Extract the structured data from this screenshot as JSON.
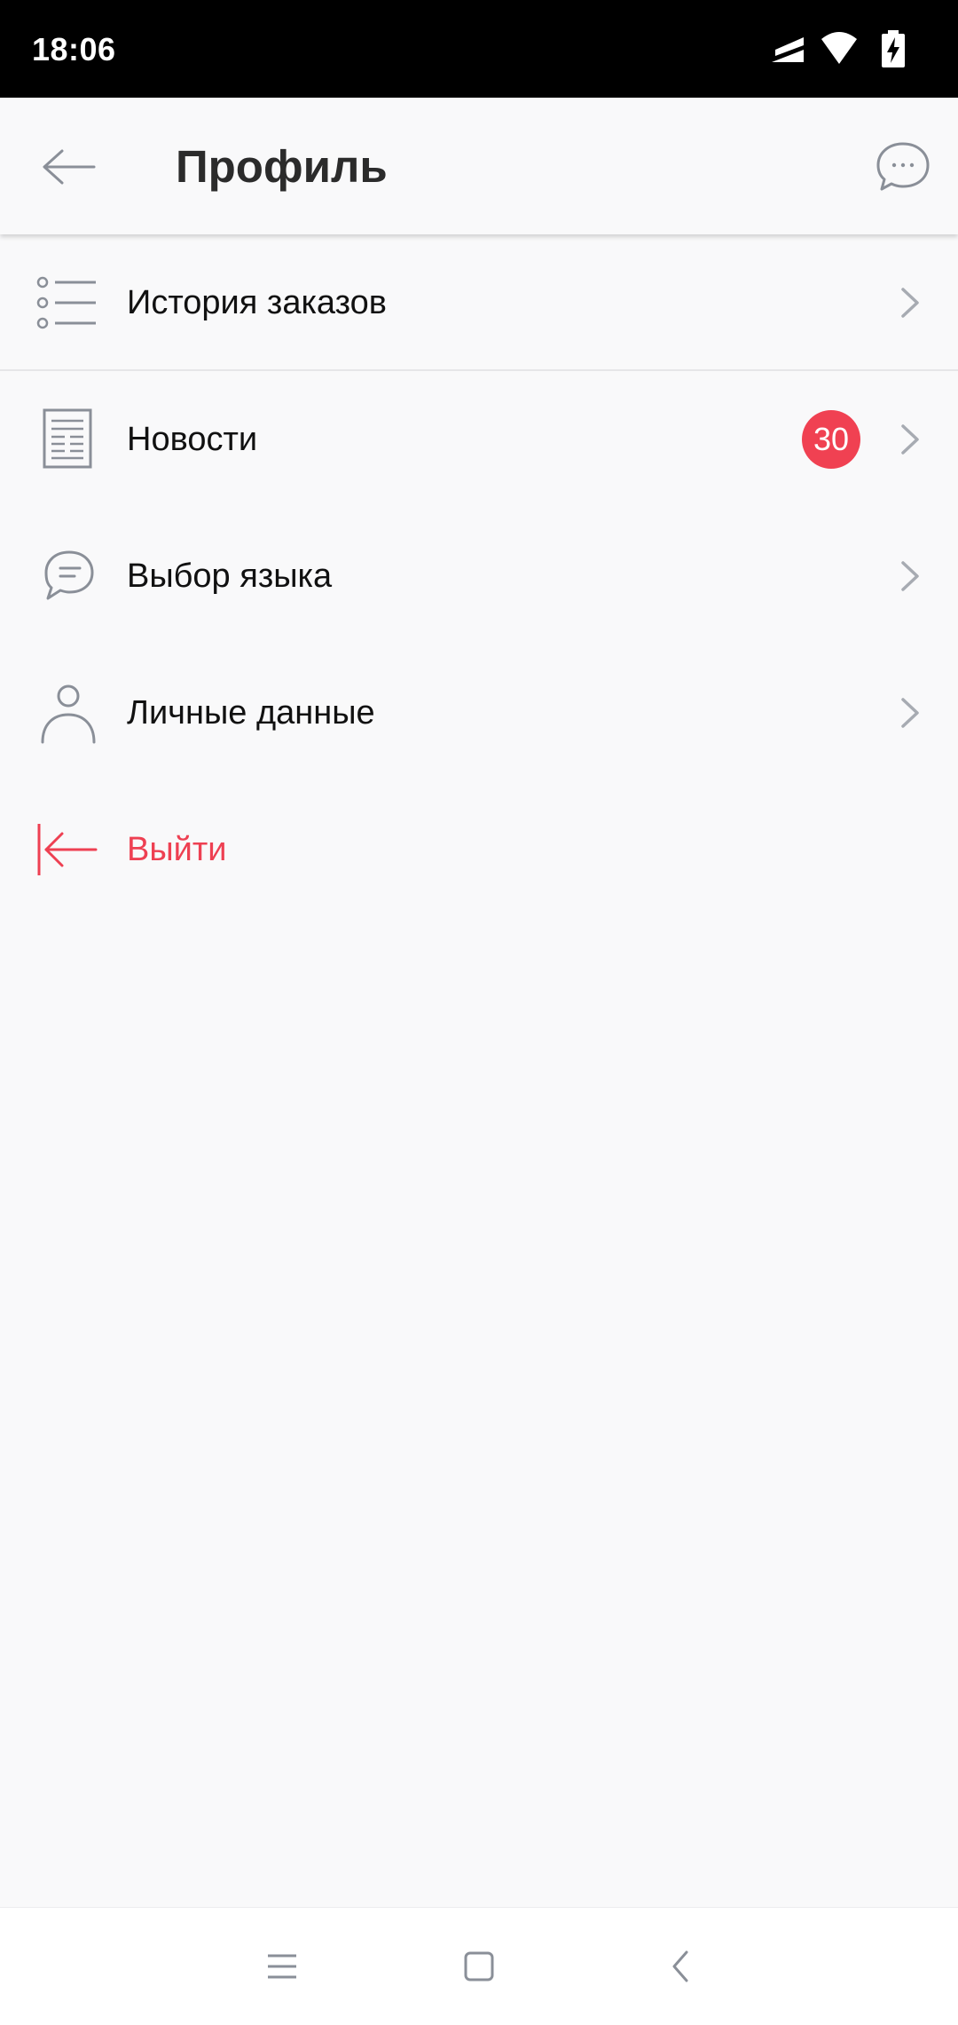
{
  "status_bar": {
    "time": "18:06"
  },
  "header": {
    "title": "Профиль",
    "back_icon": "arrow-left-icon",
    "chat_icon": "chat-bubble-icon"
  },
  "menu": {
    "items": [
      {
        "label": "История заказов",
        "icon": "list-icon"
      },
      {
        "label": "Новости",
        "icon": "newspaper-icon",
        "badge": "30"
      },
      {
        "label": "Выбор языка",
        "icon": "speech-bubble-icon"
      },
      {
        "label": "Личные данные",
        "icon": "person-icon"
      }
    ],
    "logout": {
      "label": "Выйти",
      "icon": "logout-icon"
    }
  },
  "colors": {
    "background": "#F9F9FA",
    "accent_red": "#EE4052",
    "badge": "#F04152",
    "icon_gray": "#8A8F98"
  },
  "nav_bar": {
    "icons": [
      "menu-icon",
      "home-square-icon",
      "back-chevron-icon"
    ]
  }
}
